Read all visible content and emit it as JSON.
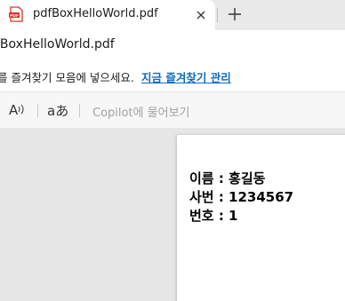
{
  "tab": {
    "title": "pdfBoxHelloWorld.pdf",
    "favicon": "pdf-file-icon",
    "close_icon": "close-icon",
    "new_tab_icon": "plus-icon"
  },
  "address": {
    "url": "fBoxHelloWorld.pdf"
  },
  "favorites_bar": {
    "prompt": "를 즐겨찾기 모음에 넣으세요.",
    "link": "지금 즐겨찾기 관리"
  },
  "pdf_toolbar": {
    "read_aloud_label": "A",
    "read_aloud_icon": "read-aloud-icon",
    "translate_label": "aあ",
    "translate_icon": "translate-icon",
    "copilot_label": "Copilot에 물어보기"
  },
  "document": {
    "lines": [
      "이름 : 홍길동",
      "사번 : 1234567",
      "번호 : 1"
    ]
  },
  "colors": {
    "link": "#0f6cbd",
    "tab_active": "#ffffff",
    "viewer_bg": "#e6e6e6",
    "pdf_icon_red": "#d93025"
  }
}
